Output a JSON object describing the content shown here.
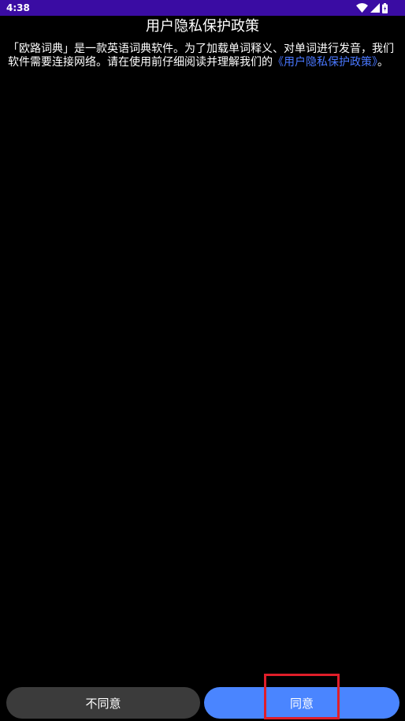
{
  "status_bar": {
    "time": "4:38",
    "bg_color": "#3a0ca3",
    "icons": [
      "wifi-icon",
      "signal-icon",
      "battery-icon"
    ]
  },
  "dialog": {
    "title": "用户隐私保护政策",
    "body_text": "「欧路词典」是一款英语词典软件。为了加载单词释义、对单词进行发音，我们软件需要连接网络。请在使用前仔细阅读并理解我们的",
    "policy_link": "《用户隐私保护政策》",
    "body_suffix": "。",
    "link_color": "#4a78ff"
  },
  "buttons": {
    "disagree_label": "不同意",
    "agree_label": "同意",
    "disagree_color": "#3b3b3b",
    "agree_color": "#4a85ff"
  },
  "highlight_color": "#e01e2a"
}
